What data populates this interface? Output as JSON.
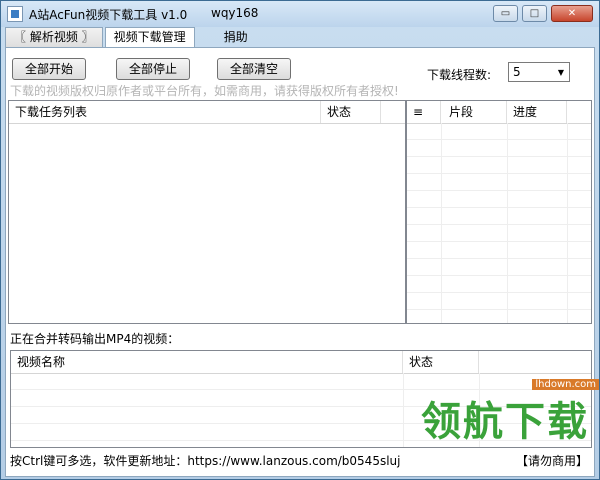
{
  "window": {
    "title": "A站AcFun视频下载工具 v1.0",
    "author": "wqy168",
    "buttons": {
      "minimize": "▭",
      "maximize": "□",
      "close": "✕"
    }
  },
  "tabs": [
    {
      "label": "〖 解析视频 〗",
      "active": false
    },
    {
      "label": "视频下载管理",
      "active": true
    },
    {
      "label": "捐助",
      "active": false
    }
  ],
  "toolbar": {
    "start_all": "全部开始",
    "stop_all": "全部停止",
    "clear_all": "全部清空",
    "thread_label": "下载线程数:",
    "thread_value": "5"
  },
  "notice": "下载的视频版权归原作者或平台所有，如需商用，请获得版权所有者授权!",
  "task_table": {
    "columns": [
      "下载任务列表",
      "状态"
    ]
  },
  "segment_table": {
    "columns": [
      "≡",
      "片段",
      "进度"
    ]
  },
  "merge_label": "正在合并转码输出MP4的视频：",
  "video_table": {
    "columns": [
      "视频名称",
      "状态"
    ]
  },
  "footer": {
    "hint": "按Ctrl键可多选，软件更新地址：https://www.lanzous.com/b0545sluj",
    "right_text": "【请勿商用】"
  },
  "watermark": {
    "url": "lhdown.com",
    "text": "领航下载"
  },
  "colors": {
    "notice_text": "#b4b4b4",
    "watermark_green": "#3aa23a",
    "watermark_orange": "#d97a2a"
  }
}
